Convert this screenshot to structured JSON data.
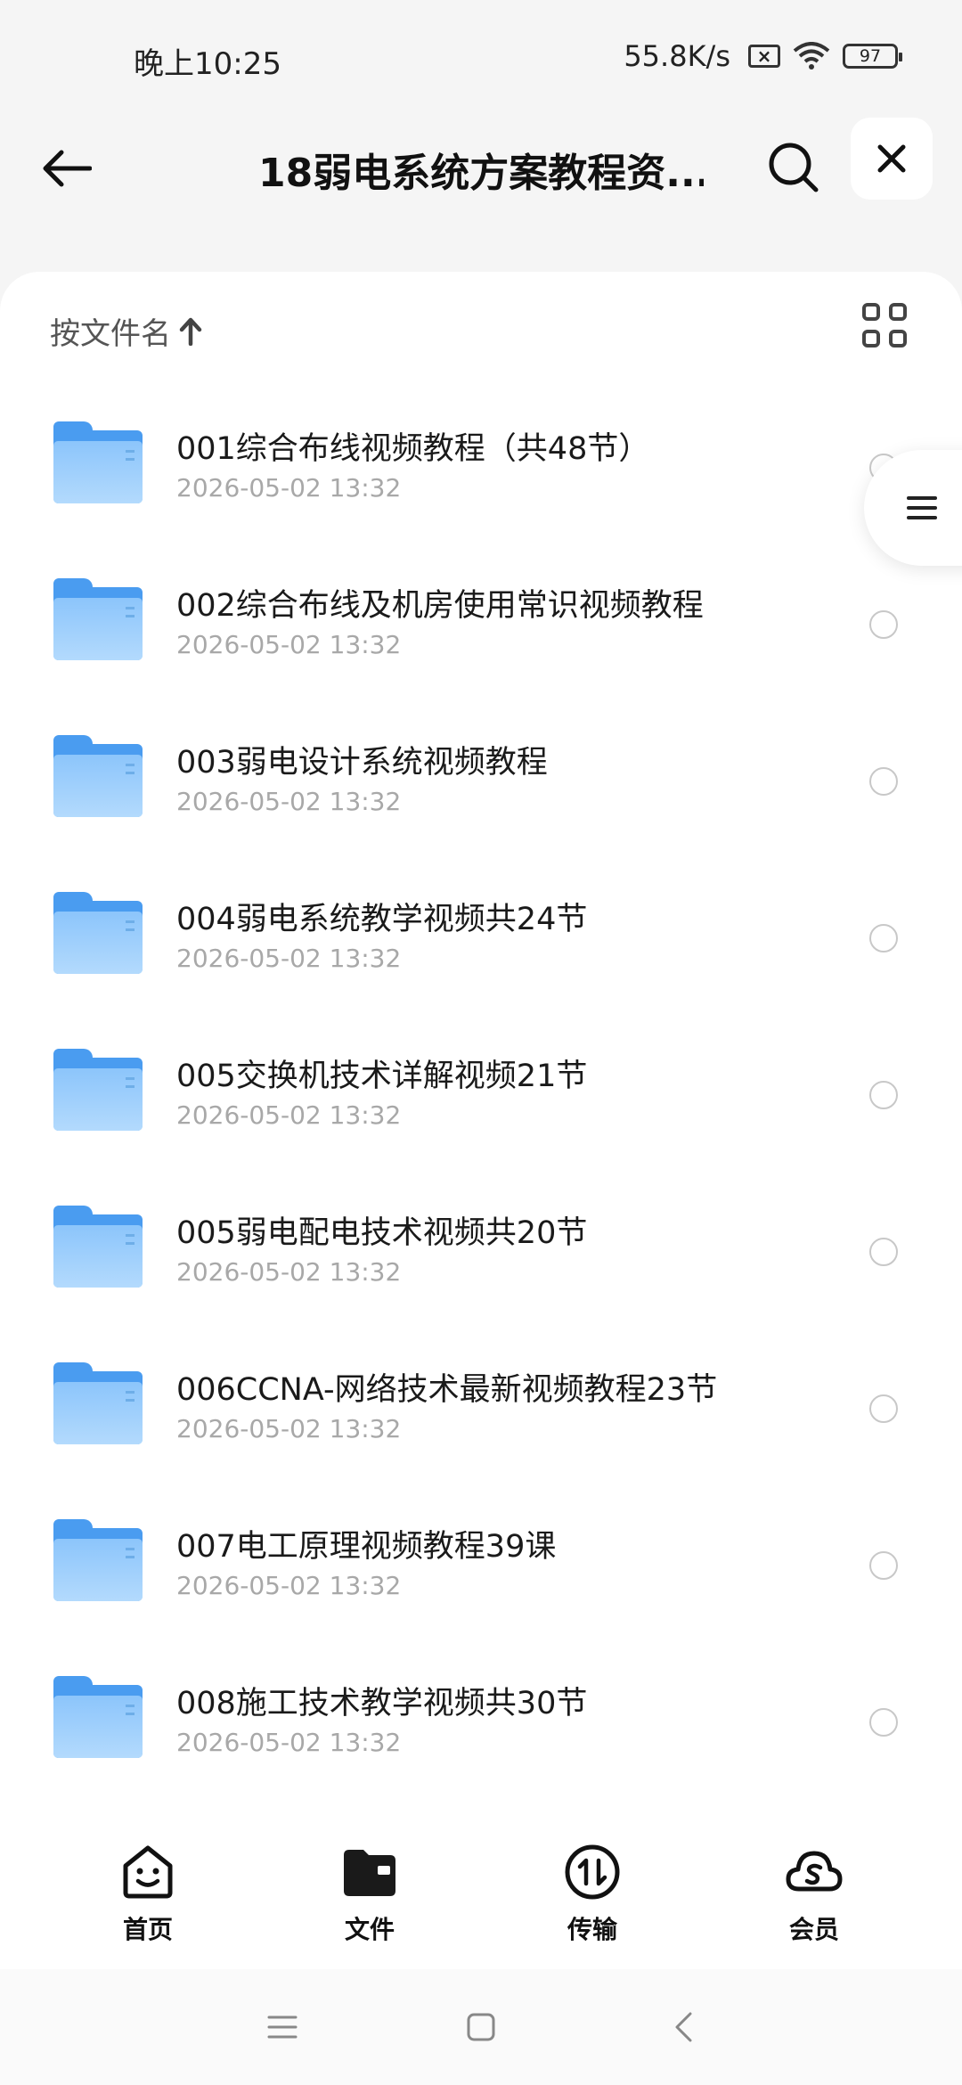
{
  "status_bar": {
    "time": "晚上10:25",
    "net_speed": "55.8K/s",
    "sim_icon": "sim-x-icon",
    "wifi_icon": "wifi-icon",
    "battery": "97"
  },
  "header": {
    "title": "18弱电系统方案教程资...",
    "back_icon": "back-arrow-icon",
    "search_icon": "search-icon",
    "close_icon": "close-icon"
  },
  "sort": {
    "label": "按文件名",
    "direction_icon": "arrow-up-icon",
    "view_icon": "grid-view-icon"
  },
  "files": [
    {
      "name": "001综合布线视频教程（共48节）",
      "date": "2026-05-02 13:32"
    },
    {
      "name": "002综合布线及机房使用常识视频教程",
      "date": "2026-05-02 13:32"
    },
    {
      "name": "003弱电设计系统视频教程",
      "date": "2026-05-02 13:32"
    },
    {
      "name": "004弱电系统教学视频共24节",
      "date": "2026-05-02 13:32"
    },
    {
      "name": "005交换机技术详解视频21节",
      "date": "2026-05-02 13:32"
    },
    {
      "name": "005弱电配电技术视频共20节",
      "date": "2026-05-02 13:32"
    },
    {
      "name": "006CCNA-网络技术最新视频教程23节",
      "date": "2026-05-02 13:32"
    },
    {
      "name": "007电工原理视频教程39课",
      "date": "2026-05-02 13:32"
    },
    {
      "name": "008施工技术教学视频共30节",
      "date": "2026-05-02 13:32"
    }
  ],
  "bottom_nav": [
    {
      "label": "首页",
      "icon": "home-face-icon"
    },
    {
      "label": "文件",
      "icon": "folder-icon"
    },
    {
      "label": "传输",
      "icon": "transfer-icon"
    },
    {
      "label": "会员",
      "icon": "cloud-member-icon"
    }
  ],
  "colors": {
    "folder_blue": "#4a9cf0",
    "folder_light": "#b3dafd",
    "date_gray": "#a8a8a8"
  }
}
